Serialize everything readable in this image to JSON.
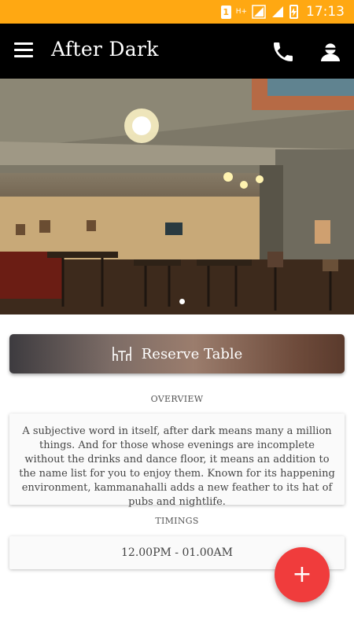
{
  "status_bar": {
    "notification_badge": "1",
    "network_type": "H+",
    "time": "17:13",
    "background_color": "#ffa812",
    "icons": [
      "notification-icon",
      "network-icon",
      "signal-icon",
      "battery-icon"
    ]
  },
  "app_bar": {
    "title": "After Dark",
    "menu_icon": "menu-icon",
    "phone_icon": "phone-icon",
    "profile_icon": "profile-icon",
    "background_color": "#000000"
  },
  "hero": {
    "image_label": "restaurant-interior-photo",
    "carousel_dots": 1
  },
  "reserve": {
    "label": "Reserve Table",
    "icon": "table-chairs-icon"
  },
  "overview": {
    "heading": "OVERVIEW",
    "text": "A subjective word in itself, after dark means many a million things. And for those whose evenings are incomplete without the drinks and dance floor, it means an addition to the name list for you to enjoy them. Known for its happening environment, kammanahalli adds a new feather to its hat of pubs and nightlife."
  },
  "timings": {
    "heading": "TIMINGS",
    "value": "12.00PM - 01.00AM"
  },
  "fab": {
    "label": "+",
    "color": "#f03c3c"
  }
}
